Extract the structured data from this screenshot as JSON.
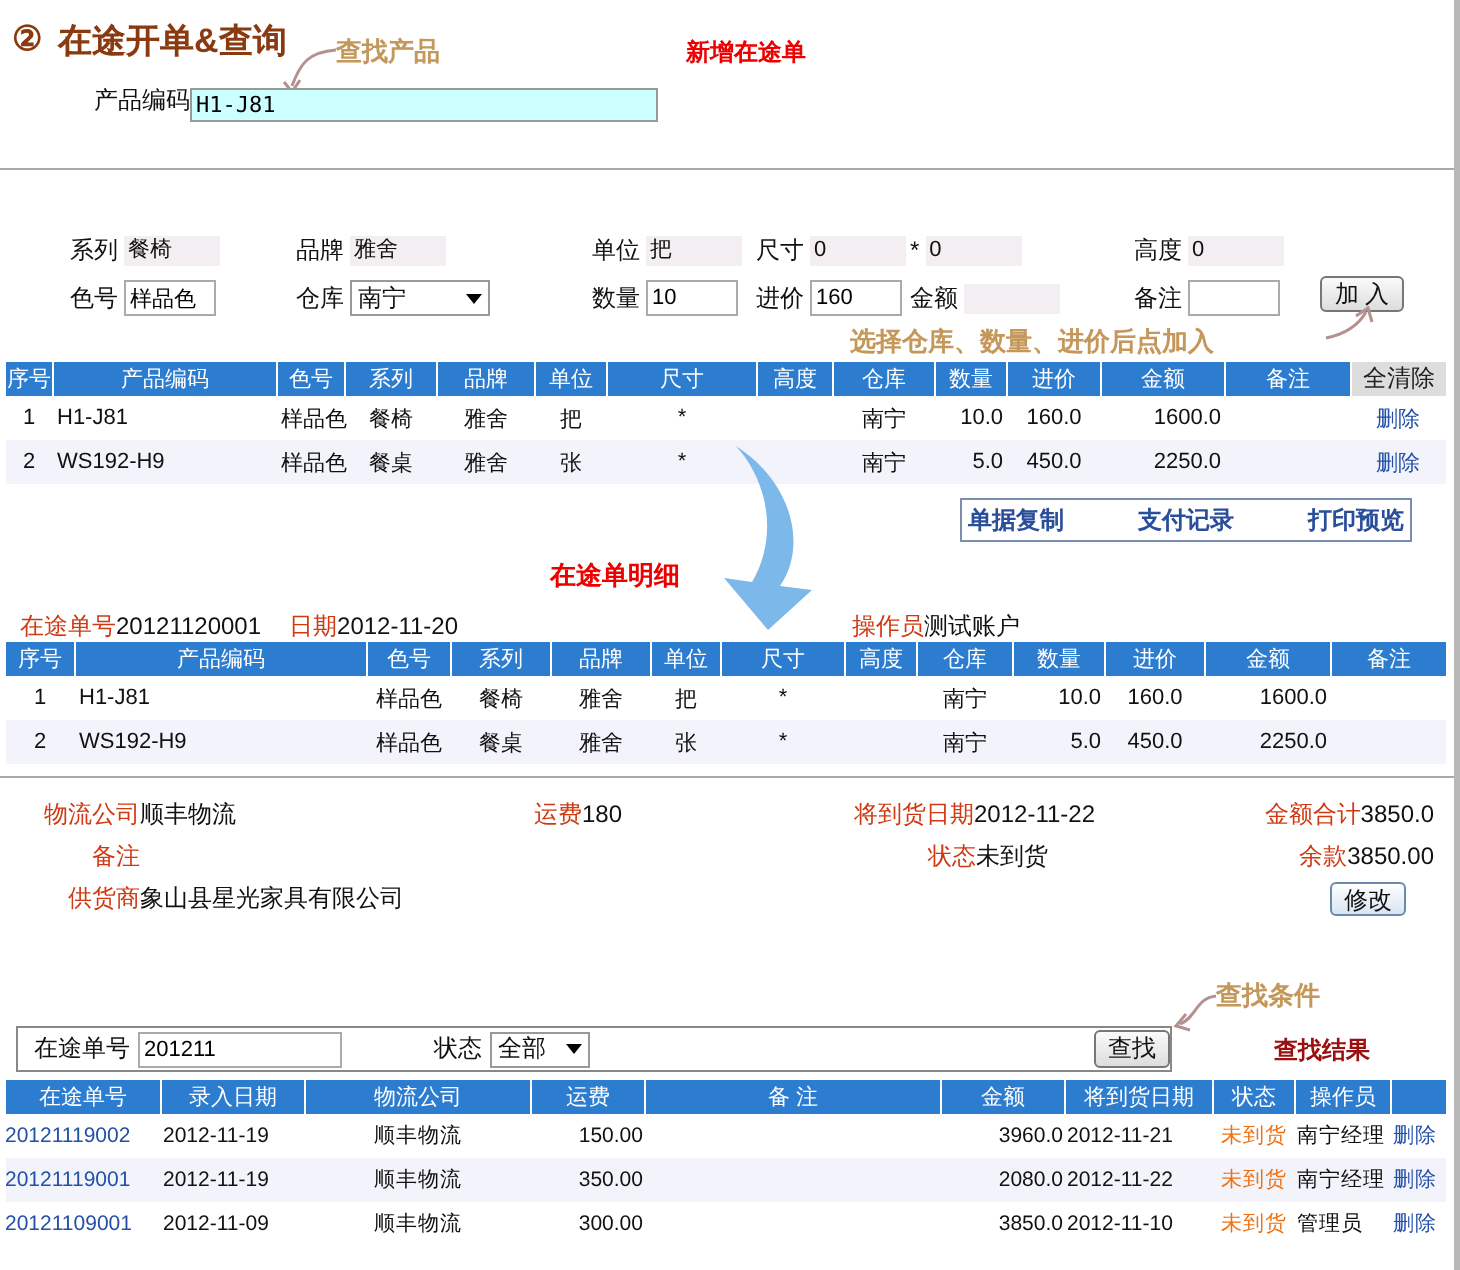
{
  "title": {
    "number": "②",
    "text": "在途开单&查询"
  },
  "new_order_link": "新增在途单",
  "product_search": {
    "callout": "查找产品",
    "label": "产品编码",
    "value": "H1-J81"
  },
  "form": {
    "rows": [
      [
        {
          "label": "系列",
          "value": "餐椅",
          "kind": "readonly"
        },
        {
          "label": "品牌",
          "value": "雅舍",
          "kind": "readonly"
        },
        {
          "label": "单位",
          "value": "把",
          "kind": "readonly"
        },
        {
          "label": "尺寸",
          "value": "0",
          "kind": "readonly"
        },
        {
          "label": "*",
          "value": "0",
          "kind": "readonly"
        },
        {
          "label": "高度",
          "value": "0",
          "kind": "readonly"
        }
      ],
      [
        {
          "label": "色号",
          "value": "样品色",
          "kind": "input"
        },
        {
          "label": "仓库",
          "value": "南宁",
          "kind": "select"
        },
        {
          "label": "数量",
          "value": "10",
          "kind": "input"
        },
        {
          "label": "进价",
          "value": "160",
          "kind": "input"
        },
        {
          "label": "金额",
          "kind": "readonly"
        },
        {
          "label": "备注",
          "kind": "input"
        }
      ]
    ],
    "add_button": "加 入",
    "hint": "选择仓库、数量、进价后点加入"
  },
  "cart": {
    "columns": [
      "序号",
      "产品编码",
      "色号",
      "系列",
      "品牌",
      "单位",
      "尺寸",
      "高度",
      "仓库",
      "数量",
      "进价",
      "金额",
      "备注"
    ],
    "clear_all_button": "全清除",
    "rows": [
      {
        "no": "1",
        "code": "H1-J81",
        "color_no": "样品色",
        "series": "餐椅",
        "brand": "雅舍",
        "unit": "把",
        "size": "*",
        "warehouse": "南宁",
        "qty": "10.0",
        "price": "160.0",
        "amount": "1600.0",
        "action": "删除"
      },
      {
        "no": "2",
        "code": "WS192-H9",
        "color_no": "样品色",
        "series": "餐桌",
        "brand": "雅舍",
        "unit": "张",
        "size": "*",
        "warehouse": "南宁",
        "qty": "5.0",
        "price": "450.0",
        "amount": "2250.0",
        "action": "删除"
      }
    ]
  },
  "actions": [
    "单据复制",
    "支付记录",
    "打印预览"
  ],
  "detail": {
    "caption": "在途单明细",
    "order_no": {
      "label": "在途单号",
      "value": "20121120001"
    },
    "date": {
      "label": "日期",
      "value": "2012-11-20"
    },
    "operator": {
      "label": "操作员",
      "value": "测试账户"
    },
    "columns": [
      "序号",
      "产品编码",
      "色号",
      "系列",
      "品牌",
      "单位",
      "尺寸",
      "高度",
      "仓库",
      "数量",
      "进价",
      "金额",
      "备注"
    ],
    "rows": [
      {
        "no": "1",
        "code": "H1-J81",
        "color_no": "样品色",
        "series": "餐椅",
        "brand": "雅舍",
        "unit": "把",
        "size": "*",
        "warehouse": "南宁",
        "qty": "10.0",
        "price": "160.0",
        "amount": "1600.0"
      },
      {
        "no": "2",
        "code": "WS192-H9",
        "color_no": "样品色",
        "series": "餐桌",
        "brand": "雅舍",
        "unit": "张",
        "size": "*",
        "warehouse": "南宁",
        "qty": "5.0",
        "price": "450.0",
        "amount": "2250.0"
      }
    ]
  },
  "info": {
    "logistics": {
      "label": "物流公司",
      "value": "顺丰物流"
    },
    "freight": {
      "label": "运费",
      "value": "180"
    },
    "arrival": {
      "label": "将到货日期",
      "value": "2012-11-22"
    },
    "total": {
      "label": "金额合计",
      "value": "3850.0"
    },
    "remark": {
      "label": "备注"
    },
    "status": {
      "label": "状态",
      "value": "未到货"
    },
    "balance": {
      "label": "余款",
      "value": "3850.00"
    },
    "supplier": {
      "label": "供货商",
      "value": "象山县星光家具有限公司"
    },
    "edit_button": "修改"
  },
  "search": {
    "callout": "查找条件",
    "order_no": {
      "label": "在途单号",
      "value": "201211"
    },
    "status": {
      "label": "状态",
      "value": "全部"
    },
    "button": "查找",
    "results_label": "查找结果"
  },
  "results": {
    "columns": [
      "在途单号",
      "录入日期",
      "物流公司",
      "运费",
      "备 注",
      "金额",
      "将到货日期",
      "状态",
      "操作员"
    ],
    "rows": [
      {
        "order_no": "20121119002",
        "date": "2012-11-19",
        "company": "顺丰物流",
        "freight": "150.00",
        "amount": "3960.0",
        "arrival": "2012-11-21",
        "status": "未到货",
        "operator": "南宁经理",
        "action": "删除"
      },
      {
        "order_no": "20121119001",
        "date": "2012-11-19",
        "company": "顺丰物流",
        "freight": "350.00",
        "amount": "2080.0",
        "arrival": "2012-11-22",
        "status": "未到货",
        "operator": "南宁经理",
        "action": "删除"
      },
      {
        "order_no": "20121109001",
        "date": "2012-11-09",
        "company": "顺丰物流",
        "freight": "300.00",
        "amount": "3850.0",
        "arrival": "2012-11-10",
        "status": "未到货",
        "operator": "管理员",
        "action": "删除"
      }
    ]
  }
}
